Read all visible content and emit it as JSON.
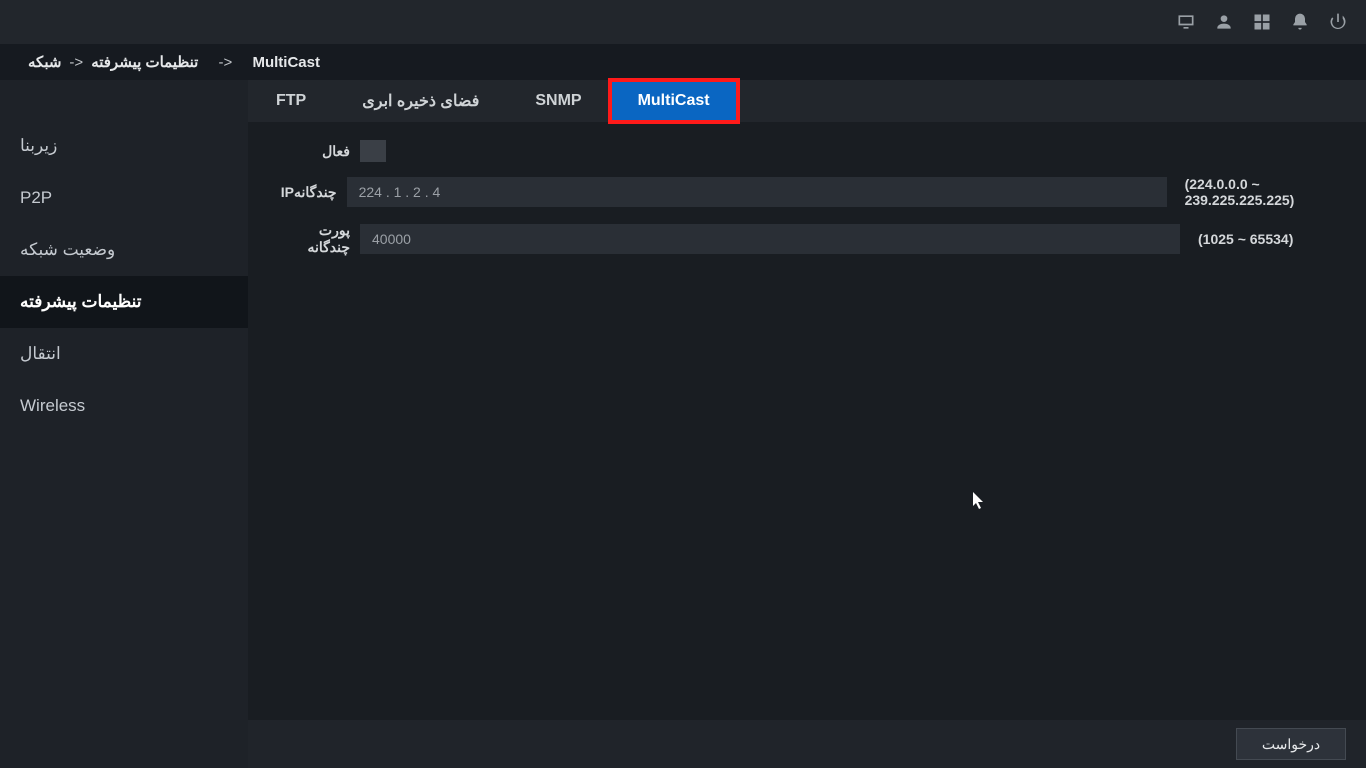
{
  "breadcrumb": {
    "root": "شبکه",
    "mid": "تنظیمات پیشرفته",
    "leaf": "MultiCast",
    "sep1": "->",
    "sep2": "->"
  },
  "sidebar": {
    "items": [
      {
        "label": "زیربنا"
      },
      {
        "label": "P2P"
      },
      {
        "label": "وضعیت شبکه"
      },
      {
        "label": "تنظیمات پیشرفته"
      },
      {
        "label": "انتقال"
      },
      {
        "label": "Wireless"
      }
    ],
    "active_index": 3
  },
  "tabs": {
    "items": [
      {
        "label": "FTP"
      },
      {
        "label": "فضای ذخیره ابری"
      },
      {
        "label": "SNMP"
      },
      {
        "label": "MultiCast"
      }
    ],
    "active_index": 3,
    "highlight_index": 3
  },
  "form": {
    "enable_label": "فعال",
    "ip_label": "IPچندگانه",
    "ip_value": "224 . 1 . 2 . 4",
    "ip_hint": "(224.0.0.0 ~ 239.225.225.225)",
    "port_label": "پورت چندگانه",
    "port_value": "40000",
    "port_hint": "(1025 ~ 65534)"
  },
  "footer": {
    "apply_label": "درخواست"
  },
  "topbar_icons": {
    "monitor": "monitor-icon",
    "user": "user-icon",
    "grid": "grid-icon",
    "bell": "bell-icon",
    "power": "power-icon"
  }
}
